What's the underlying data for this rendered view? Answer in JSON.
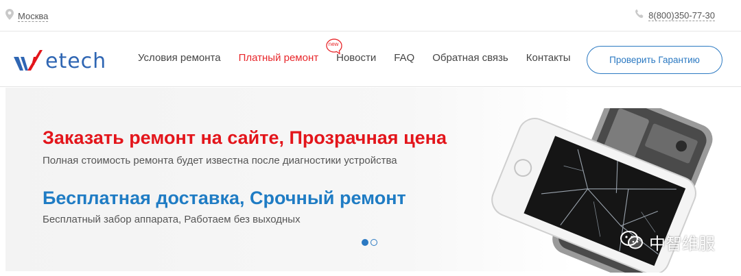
{
  "topbar": {
    "city": "Москва",
    "phone": "8(800)350-77-30"
  },
  "header": {
    "logo_text": "etech",
    "nav": [
      {
        "label": "Условия ремонта"
      },
      {
        "label": "Платный ремонт",
        "badge": "new",
        "active": true
      },
      {
        "label": "Новости"
      },
      {
        "label": "FAQ"
      },
      {
        "label": "Обратная связь"
      },
      {
        "label": "Контакты"
      }
    ],
    "cta_label": "Проверить Гарантию"
  },
  "hero": {
    "heading1": "Заказать ремонт на сайте, Прозрачная цена",
    "subtitle1": "Полная стоимость ремонта будет известна после диагностики устройства",
    "heading2": "Бесплатная доставка, Срочный ремонт",
    "subtitle2": "Бесплатный забор аппарата, Работаем без выходных",
    "slides_total": 2,
    "slide_active": 1
  },
  "watermark": {
    "text": "中智维服"
  },
  "colors": {
    "brand_blue": "#2b79c2",
    "accent_red": "#e3151b"
  }
}
